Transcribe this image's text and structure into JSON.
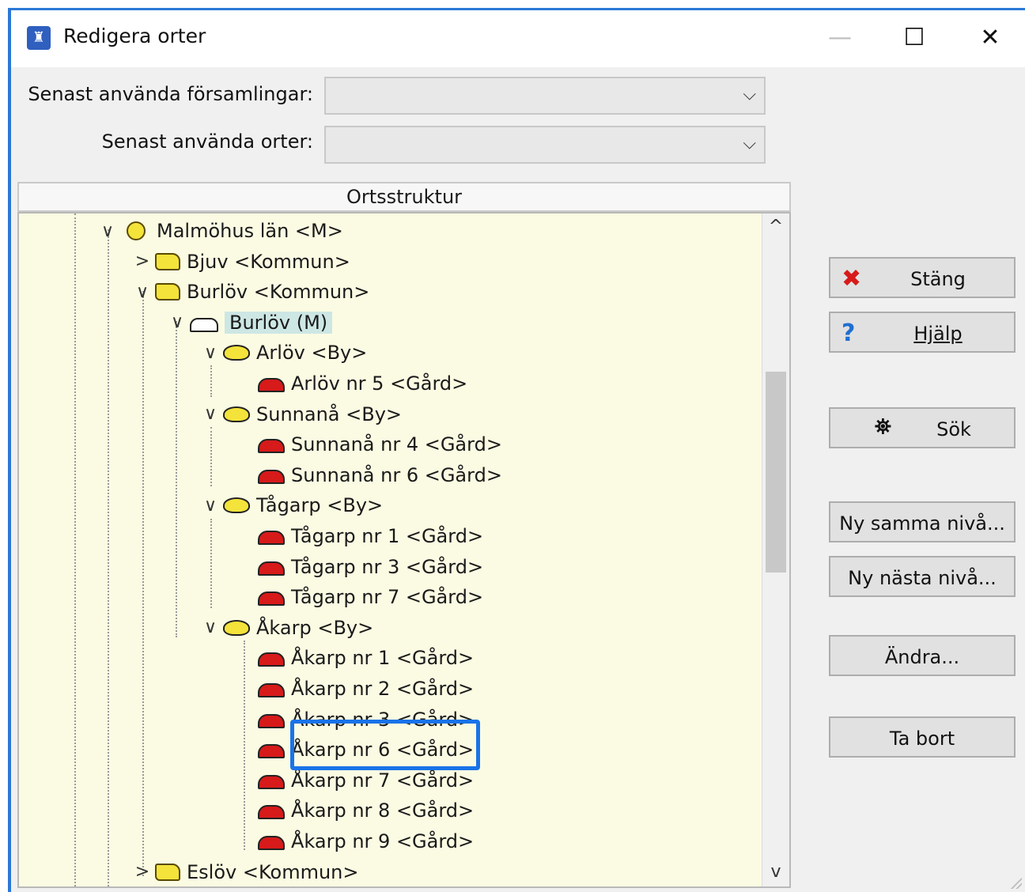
{
  "window": {
    "title": "Redigera orter",
    "app_icon": "ortstruktur-app-icon",
    "controls": {
      "minimize": "—",
      "maximize": "☐",
      "close": "✕"
    }
  },
  "form": {
    "label_forsamlingar": "Senast använda församlingar:",
    "value_forsamlingar": "",
    "label_orter": "Senast använda orter:",
    "value_orter": ""
  },
  "tree": {
    "header": "Ortsstruktur",
    "nodes": [
      {
        "label": "Malmöhus län <M>",
        "expander": "∨",
        "icon": "lan-icon"
      },
      {
        "label": "Bjuv <Kommun>",
        "expander": ">",
        "icon": "kommun-icon"
      },
      {
        "label": "Burlöv <Kommun>",
        "expander": "∨",
        "icon": "kommun-icon"
      },
      {
        "label": "Burlöv (M)",
        "expander": "∨",
        "icon": "forsamling-icon",
        "selected": true
      },
      {
        "label": "Arlöv <By>",
        "expander": "∨",
        "icon": "by-icon"
      },
      {
        "label": "Arlöv nr 5 <Gård>",
        "icon": "gard-icon"
      },
      {
        "label": "Sunnanå <By>",
        "expander": "∨",
        "icon": "by-icon"
      },
      {
        "label": "Sunnanå nr 4 <Gård>",
        "icon": "gard-icon"
      },
      {
        "label": "Sunnanå nr 6 <Gård>",
        "icon": "gard-icon"
      },
      {
        "label": "Tågarp <By>",
        "expander": "∨",
        "icon": "by-icon"
      },
      {
        "label": "Tågarp nr 1 <Gård>",
        "icon": "gard-icon"
      },
      {
        "label": "Tågarp nr 3 <Gård>",
        "icon": "gard-icon"
      },
      {
        "label": "Tågarp nr 7 <Gård>",
        "icon": "gard-icon"
      },
      {
        "label": "Åkarp <By>",
        "expander": "∨",
        "icon": "by-icon"
      },
      {
        "label": "Åkarp nr 1 <Gård>",
        "icon": "gard-icon"
      },
      {
        "label": "Åkarp nr 2 <Gård>",
        "icon": "gard-icon"
      },
      {
        "label": "Åkarp nr 3 <Gård>",
        "icon": "gard-icon"
      },
      {
        "label": "Åkarp nr 6 <Gård>",
        "icon": "gard-icon",
        "highlighted": true
      },
      {
        "label": "Åkarp nr 7 <Gård>",
        "icon": "gard-icon"
      },
      {
        "label": "Åkarp nr 8 <Gård>",
        "icon": "gard-icon"
      },
      {
        "label": "Åkarp nr 9 <Gård>",
        "icon": "gard-icon"
      },
      {
        "label": "Eslöv <Kommun>",
        "expander": ">",
        "icon": "kommun-icon"
      }
    ],
    "scroll_up": "^",
    "scroll_down": "v"
  },
  "buttons": {
    "stang": {
      "label": "Stäng",
      "icon": "✖"
    },
    "hjalp": {
      "label": "Hjälp",
      "icon": "?"
    },
    "sok": {
      "label": "Sök",
      "icon": "binoculars-icon"
    },
    "ny_samma": "Ny samma nivå...",
    "ny_nasta": "Ny nästa nivå...",
    "andra": "Ändra...",
    "ta_bort": "Ta bort"
  },
  "colors": {
    "accent": "#1a73e8",
    "tree_background": "#fbfbe3",
    "selection": "#cde7e4",
    "gard_red": "#d71a1a",
    "yellow": "#f4e33a"
  }
}
